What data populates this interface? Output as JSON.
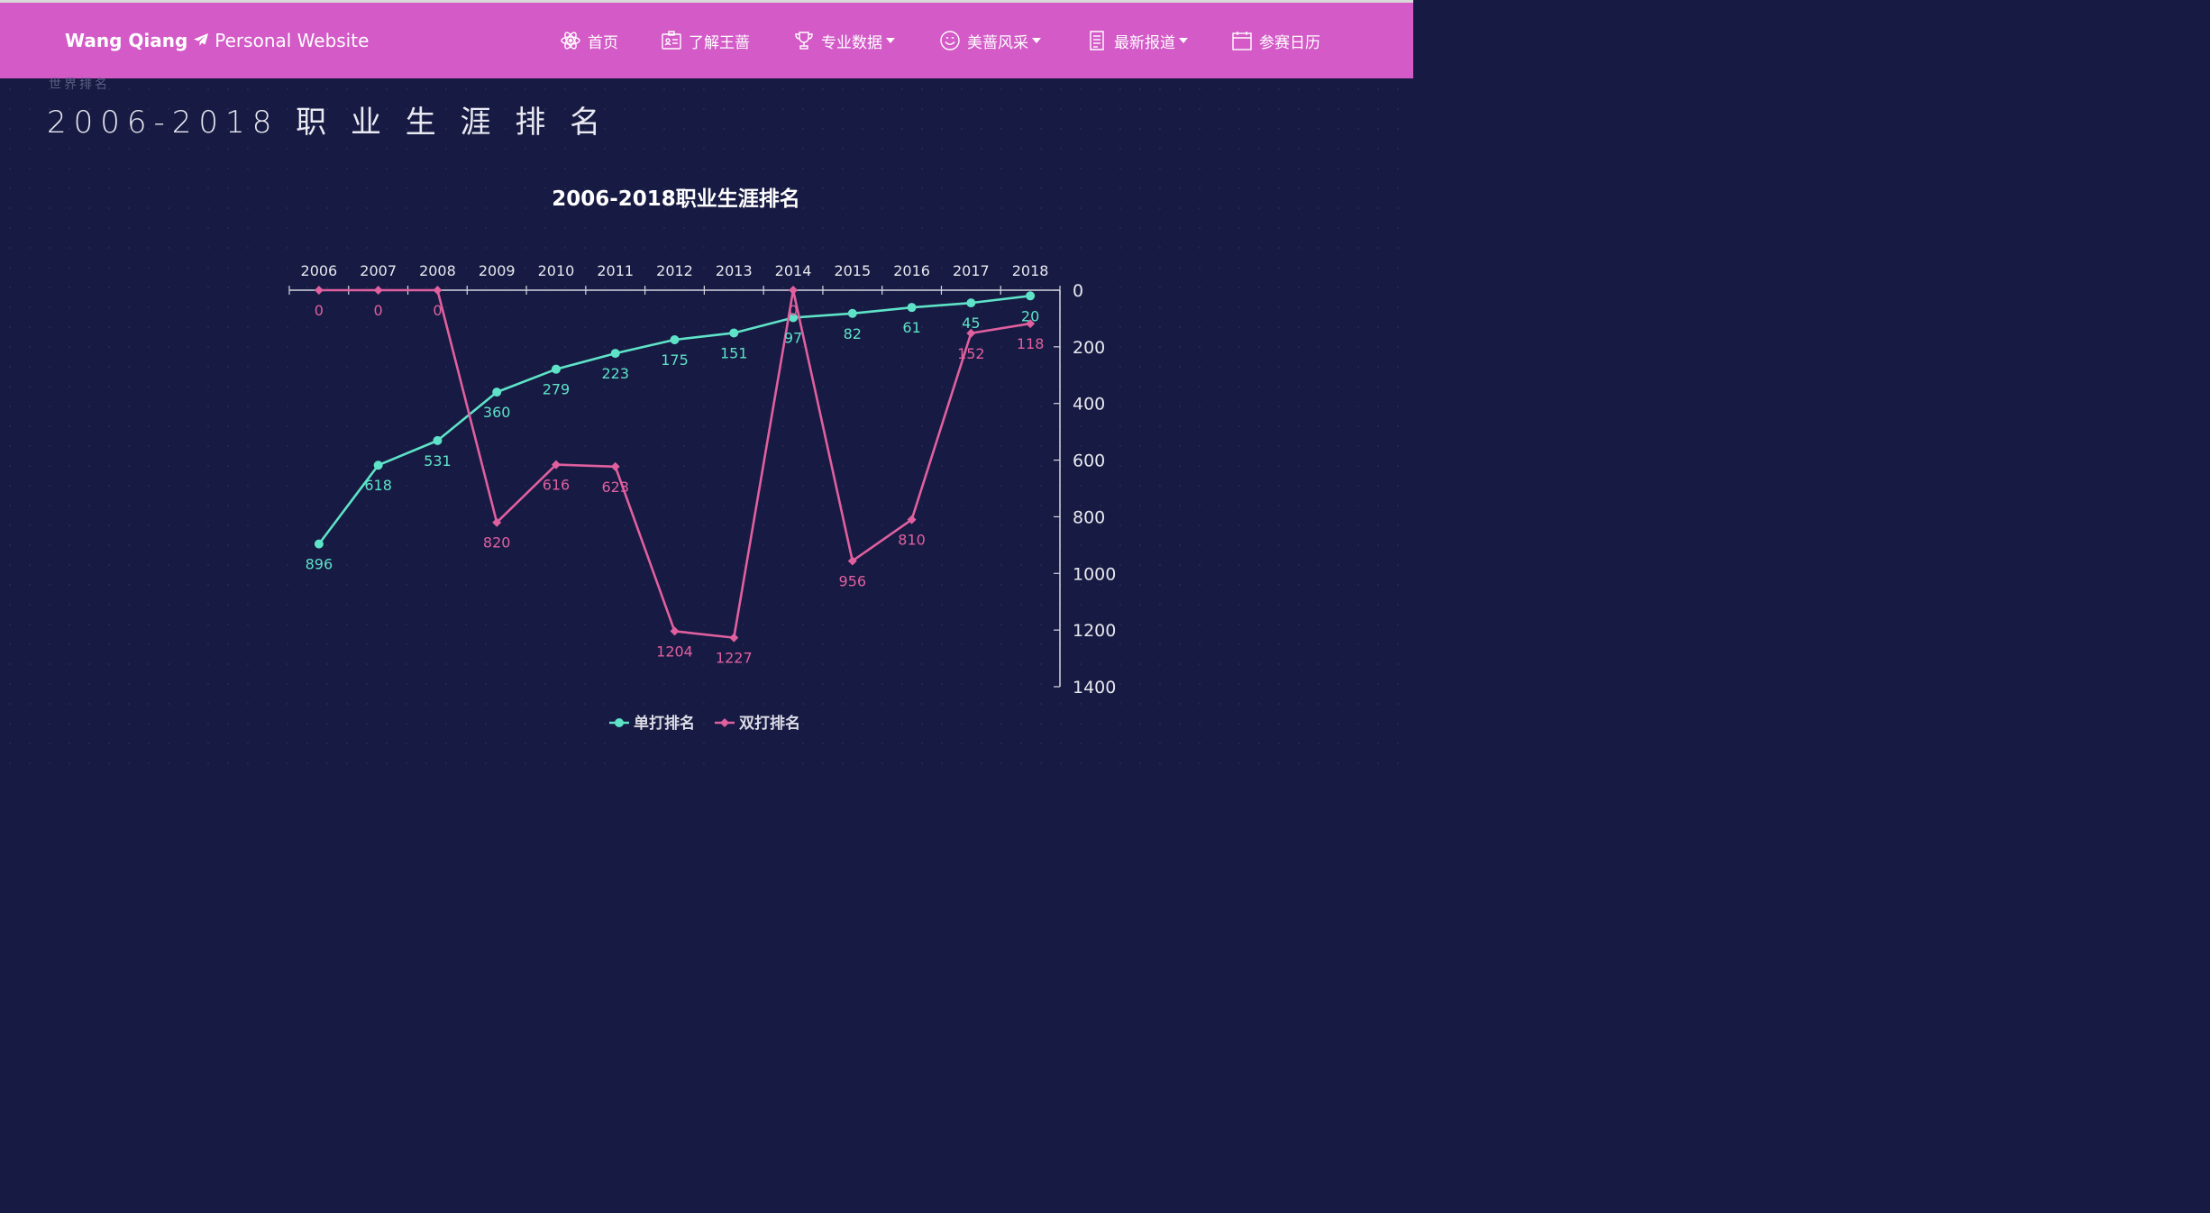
{
  "header": {
    "brand_name": "Wang Qiang",
    "brand_suffix": "Personal Website",
    "nav": [
      {
        "label": "首页",
        "icon": "atom-icon",
        "dropdown": false
      },
      {
        "label": "了解王蔷",
        "icon": "id-card-icon",
        "dropdown": false
      },
      {
        "label": "专业数据",
        "icon": "trophy-icon",
        "dropdown": true
      },
      {
        "label": "美蔷风采",
        "icon": "smile-icon",
        "dropdown": true
      },
      {
        "label": "最新报道",
        "icon": "document-icon",
        "dropdown": true
      },
      {
        "label": "参赛日历",
        "icon": "calendar-icon",
        "dropdown": false
      }
    ]
  },
  "section": {
    "subtitle": "世界排名",
    "title": "2006-2018 职 业 生 涯 排 名"
  },
  "colors": {
    "background": "#171a42",
    "navbar": "#d35ac7",
    "singles": "#5ee3c8",
    "doubles": "#e0609f"
  },
  "chart_data": {
    "type": "line",
    "title": "2006-2018职业生涯排名",
    "categories": [
      "2006",
      "2007",
      "2008",
      "2009",
      "2010",
      "2011",
      "2012",
      "2013",
      "2014",
      "2015",
      "2016",
      "2017",
      "2018"
    ],
    "x_axis_position": "top",
    "y_axis_position": "right",
    "y_inverse": true,
    "ylim": [
      0,
      1400
    ],
    "yticks": [
      0,
      200,
      400,
      600,
      800,
      1000,
      1200,
      1400
    ],
    "legend_position": "bottom-center",
    "series": [
      {
        "name": "单打排名",
        "color": "#5ee3c8",
        "marker": "circle",
        "values": [
          896,
          618,
          531,
          360,
          279,
          223,
          175,
          151,
          97,
          82,
          61,
          45,
          20
        ]
      },
      {
        "name": "双打排名",
        "color": "#e0609f",
        "marker": "diamond",
        "values": [
          0,
          0,
          0,
          820,
          616,
          623,
          1204,
          1227,
          0,
          956,
          810,
          152,
          118
        ]
      }
    ]
  }
}
